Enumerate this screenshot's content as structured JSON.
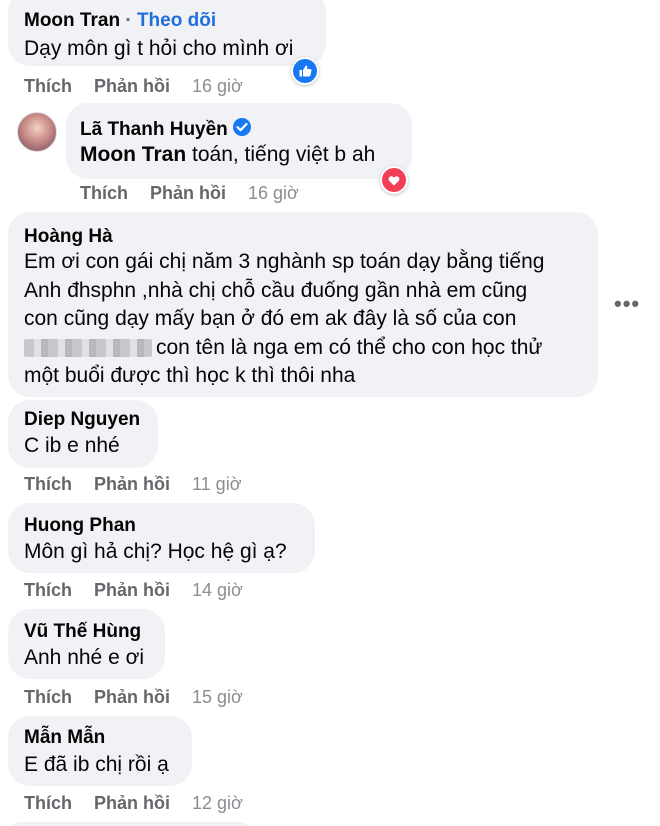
{
  "comments": [
    {
      "author": "Moon Tran",
      "follow_label": "Theo dõi",
      "text": "Dạy môn gì t hỏi cho mình ơi",
      "like_label": "Thích",
      "reply_label": "Phản hồi",
      "time": "16 giờ",
      "reaction": "like"
    },
    {
      "author": "Lã Thanh Huyền",
      "verified": true,
      "mention": "Moon Tran",
      "text": " toán, tiếng việt b ah",
      "like_label": "Thích",
      "reply_label": "Phản hồi",
      "time": "16 giờ",
      "reaction": "love"
    },
    {
      "author": "Hoàng Hà",
      "lines": [
        "Em ơi con gái chị năm 3 nghành sp toán dạy bằng tiếng",
        "Anh đhsphn ,nhà chị chỗ cầu đuống gần nhà em cũng",
        "con cũng dạy mấy bạn ở đó em ak đây là số của con",
        "con tên là nga em có thể cho con học thử",
        "một buổi được thì học k thì thôi nha"
      ]
    },
    {
      "author": "Diep Nguyen",
      "text": "C ib e nhé",
      "like_label": "Thích",
      "reply_label": "Phản hồi",
      "time": "11 giờ"
    },
    {
      "author": "Huong Phan",
      "text": "Môn gì hả chị? Học hệ gì ạ?",
      "like_label": "Thích",
      "reply_label": "Phản hồi",
      "time": "14 giờ"
    },
    {
      "author": "Vũ Thế Hùng",
      "text": "Anh nhé e ơi",
      "like_label": "Thích",
      "reply_label": "Phản hồi",
      "time": "15 giờ"
    },
    {
      "author": "Mẫn Mẫn",
      "text": "E đã ib chị rồi ạ",
      "like_label": "Thích",
      "reply_label": "Phản hồi",
      "time": "12 giờ"
    }
  ],
  "more_options": "•••",
  "colors": {
    "bubble": "#f0f2f5",
    "link": "#216fdb",
    "like": "#1877f2",
    "love": "#f33e58"
  },
  "icons": [
    "like-reaction-icon",
    "love-reaction-icon",
    "verified-badge-icon",
    "more-options-icon"
  ]
}
